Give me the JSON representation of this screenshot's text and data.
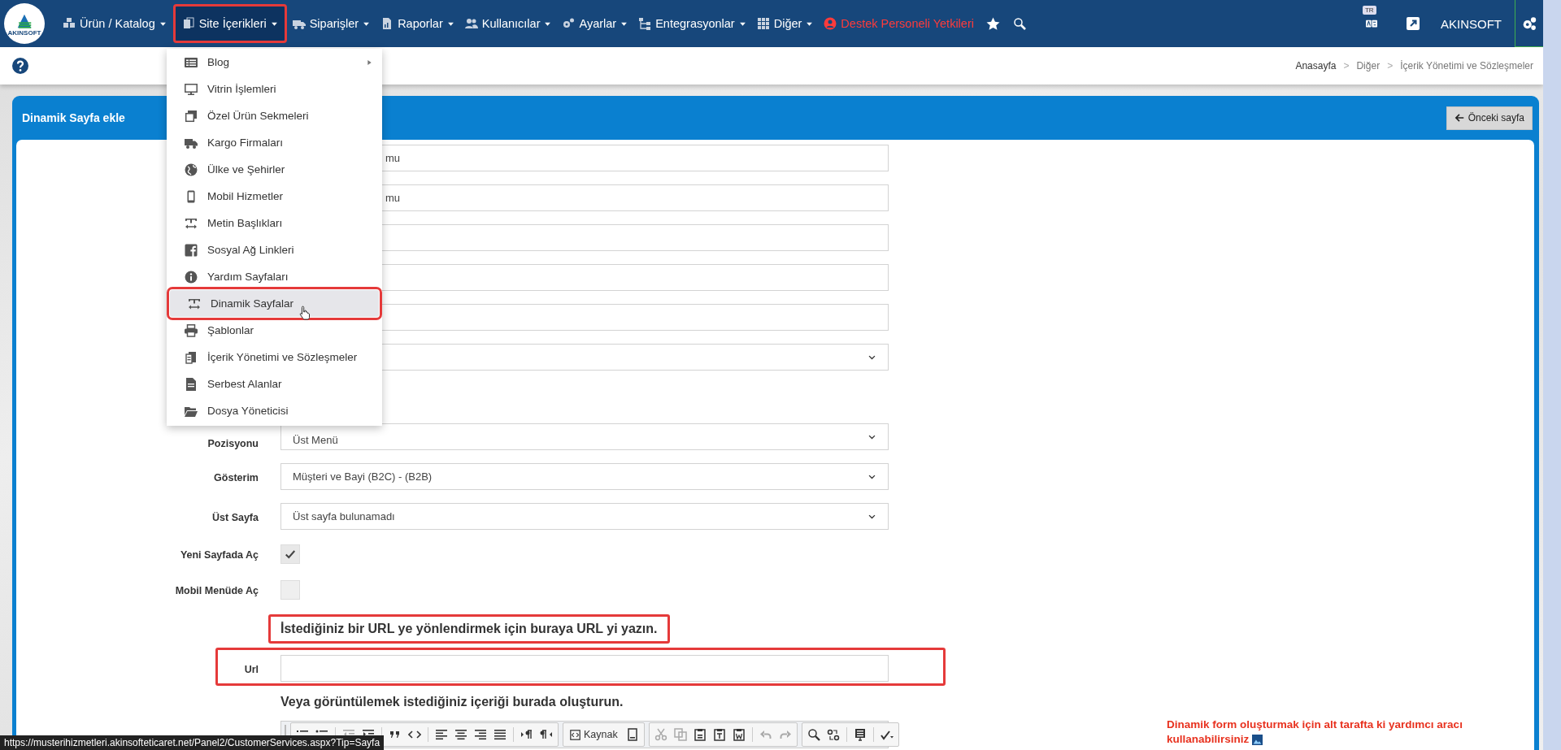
{
  "navbar": {
    "logo_text": "AKINSOFT",
    "items": [
      {
        "label": "Ürün / Katalog",
        "kind": "dropdown",
        "selected": false,
        "annotated": false
      },
      {
        "label": "Site İçerikleri",
        "kind": "dropdown",
        "selected": true,
        "annotated": true
      },
      {
        "label": "Siparişler",
        "kind": "dropdown",
        "selected": false,
        "annotated": false
      },
      {
        "label": "Raporlar",
        "kind": "dropdown",
        "selected": false,
        "annotated": false
      },
      {
        "label": "Kullanıcılar",
        "kind": "dropdown",
        "selected": false,
        "annotated": false
      },
      {
        "label": "Ayarlar",
        "kind": "dropdown",
        "selected": false,
        "annotated": false
      },
      {
        "label": "Entegrasyonlar",
        "kind": "dropdown",
        "selected": false,
        "annotated": false
      },
      {
        "label": "Diğer",
        "kind": "dropdown",
        "selected": false,
        "annotated": false
      },
      {
        "label": "Destek Personeli Yetkileri",
        "kind": "alert",
        "selected": false,
        "annotated": false
      }
    ],
    "language_badge": "TR",
    "user": "AKINSOFT"
  },
  "submenu": {
    "items": [
      {
        "label": "Blog",
        "has_submenu": true,
        "selected": false,
        "annotated": false
      },
      {
        "label": "Vitrin İşlemleri",
        "has_submenu": false,
        "selected": false,
        "annotated": false
      },
      {
        "label": "Özel Ürün Sekmeleri",
        "has_submenu": false,
        "selected": false,
        "annotated": false
      },
      {
        "label": "Kargo Firmaları",
        "has_submenu": false,
        "selected": false,
        "annotated": false
      },
      {
        "label": "Ülke ve Şehirler",
        "has_submenu": false,
        "selected": false,
        "annotated": false
      },
      {
        "label": "Mobil Hizmetler",
        "has_submenu": false,
        "selected": false,
        "annotated": false
      },
      {
        "label": "Metin Başlıkları",
        "has_submenu": false,
        "selected": false,
        "annotated": false
      },
      {
        "label": "Sosyal Ağ Linkleri",
        "has_submenu": false,
        "selected": false,
        "annotated": false
      },
      {
        "label": "Yardım Sayfaları",
        "has_submenu": false,
        "selected": false,
        "annotated": false
      },
      {
        "label": "Dinamik Sayfalar",
        "has_submenu": false,
        "selected": true,
        "annotated": true
      },
      {
        "label": "Şablonlar",
        "has_submenu": false,
        "selected": false,
        "annotated": false
      },
      {
        "label": "İçerik Yönetimi ve Sözleşmeler",
        "has_submenu": false,
        "selected": false,
        "annotated": false
      },
      {
        "label": "Serbest Alanlar",
        "has_submenu": false,
        "selected": false,
        "annotated": false
      },
      {
        "label": "Dosya Yöneticisi",
        "has_submenu": false,
        "selected": false,
        "annotated": false
      }
    ]
  },
  "breadcrumb": {
    "separator": ">",
    "items": [
      "Anasayfa",
      "Diğer",
      "İçerik Yönetimi ve Sözleşmeler"
    ]
  },
  "panel": {
    "title": "Dinamik Sayfa ekle",
    "back_button": "Önceki sayfa",
    "fields": [
      {
        "kind": "input",
        "value": "mu",
        "partial": true
      },
      {
        "kind": "input",
        "value": "mu",
        "partial": true
      },
      {
        "kind": "input"
      },
      {
        "kind": "input"
      },
      {
        "kind": "input"
      },
      {
        "kind": "select"
      },
      {
        "kind": "blank"
      },
      {
        "kind": "select",
        "label": "Pozisyonu",
        "value": "Üst Menü"
      },
      {
        "kind": "select",
        "label": "Gösterim",
        "value": "Müşteri ve Bayi (B2C) - (B2B)"
      },
      {
        "kind": "select",
        "label": "Üst Sayfa",
        "value": "Üst sayfa bulunamadı"
      },
      {
        "kind": "checkbox",
        "label": "Yeni Sayfada Aç",
        "checked": true
      },
      {
        "kind": "checkbox",
        "label": "Mobil Menüde Aç",
        "checked": false
      },
      {
        "kind": "note",
        "text": "İstediğiniz bir URL ye yönlendirmek için buraya URL yi yazın.",
        "annotated": true
      },
      {
        "kind": "input",
        "label": "Url",
        "annotated": true
      },
      {
        "kind": "note",
        "text": "Veya görüntülemek istediğiniz içeriği burada oluşturun.",
        "annotated": false
      },
      {
        "kind": "editor",
        "source_button": "Kaynak"
      }
    ],
    "help_note": "Dinamik form oluşturmak için alt tarafta ki yardımcı aracı kullanabilirsiniz"
  },
  "status_bar": {
    "url": "https://musterihizmetleri.akinsofteticaret.net/Panel2/CustomerServices.aspx?Tip=Sayfa"
  }
}
